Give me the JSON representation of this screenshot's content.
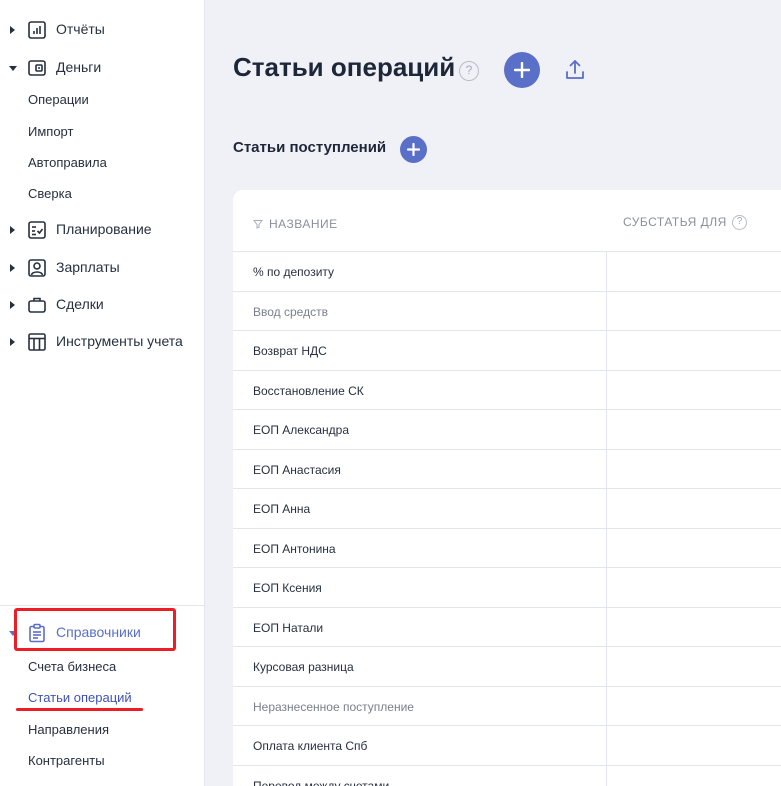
{
  "sidebar": {
    "top_groups": [
      {
        "label": "Отчёты",
        "icon": "chart-icon",
        "expanded": false
      },
      {
        "label": "Деньги",
        "icon": "wallet-icon",
        "expanded": true
      }
    ],
    "money_items": [
      "Операции",
      "Импорт",
      "Автоправила",
      "Сверка"
    ],
    "other_groups": [
      {
        "label": "Планирование",
        "icon": "checklist-icon"
      },
      {
        "label": "Зарплаты",
        "icon": "person-icon"
      },
      {
        "label": "Сделки",
        "icon": "briefcase-icon"
      },
      {
        "label": "Инструменты учета",
        "icon": "table-icon"
      }
    ],
    "directories": {
      "label": "Справочники",
      "icon": "clipboard-icon",
      "items": [
        "Счета бизнеса",
        "Статьи операций",
        "Направления",
        "Контрагенты"
      ],
      "active_item": "Статьи операций"
    }
  },
  "main": {
    "title": "Статьи операций",
    "help": "?",
    "section_title": "Статьи поступлений",
    "table": {
      "columns": [
        "НАЗВАНИЕ",
        "СУБСТАТЬЯ ДЛЯ"
      ],
      "rows": [
        {
          "name": "% по депозиту",
          "muted": false
        },
        {
          "name": "Ввод средств",
          "muted": true
        },
        {
          "name": "Возврат НДС",
          "muted": false
        },
        {
          "name": "Восстановление СК",
          "muted": false
        },
        {
          "name": "ЕОП Александра",
          "muted": false
        },
        {
          "name": "ЕОП Анастасия",
          "muted": false
        },
        {
          "name": "ЕОП Анна",
          "muted": false
        },
        {
          "name": "ЕОП Антонина",
          "muted": false
        },
        {
          "name": "ЕОП Ксения",
          "muted": false
        },
        {
          "name": "ЕОП Натали",
          "muted": false
        },
        {
          "name": "Курсовая разница",
          "muted": false
        },
        {
          "name": "Неразнесенное поступление",
          "muted": true
        },
        {
          "name": "Оплата клиента Спб",
          "muted": false
        },
        {
          "name": "Перевод между счетами",
          "muted": false
        }
      ]
    }
  },
  "colors": {
    "accent": "#5a6fc7",
    "annotation": "#ee1c25",
    "background": "#f0f1f6"
  }
}
